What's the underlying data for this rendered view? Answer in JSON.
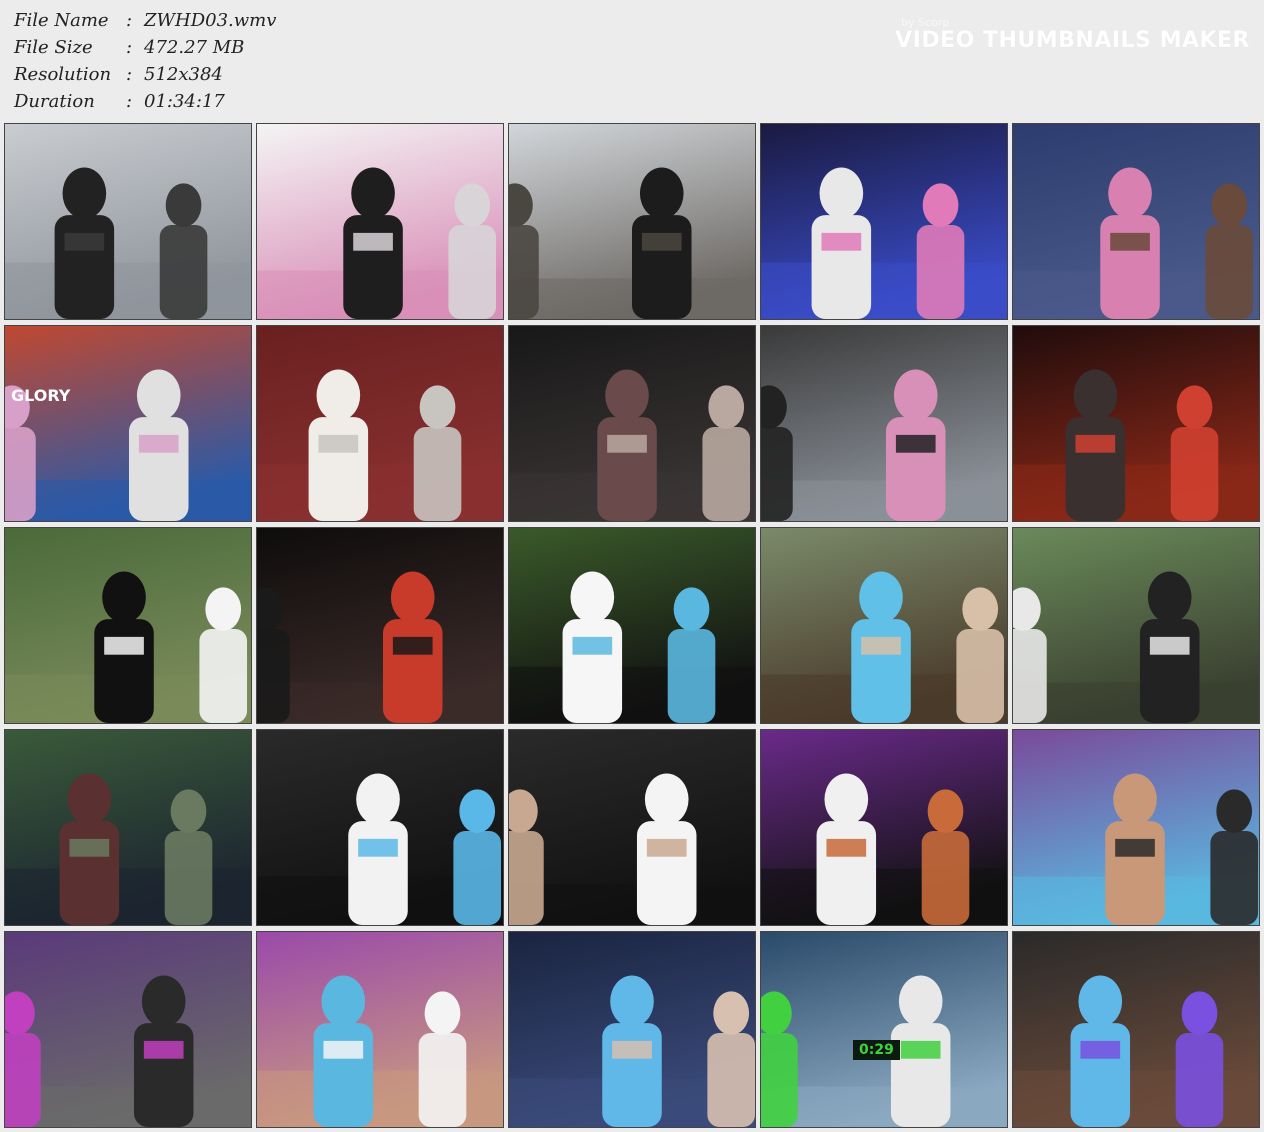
{
  "info": {
    "rows": [
      {
        "label": "File Name",
        "value": "ZWHD03.wmv"
      },
      {
        "label": "File Size",
        "value": "472.27 MB"
      },
      {
        "label": "Resolution",
        "value": "512x384"
      },
      {
        "label": "Duration",
        "value": "01:34:17"
      }
    ],
    "separator": ":"
  },
  "brand": {
    "by": "by Scorp",
    "name": "VIDEO THUMBNAILS MAKER"
  },
  "thumbnails": [
    {
      "scene": "harbor-fight",
      "palette": [
        "#c9ccd0",
        "#8f959c",
        "#222222",
        "#3a3a3a"
      ]
    },
    {
      "scene": "pink-skirt-low-angle",
      "palette": [
        "#f4f4f4",
        "#d98fb8",
        "#1e1e1e",
        "#d8d4d8"
      ]
    },
    {
      "scene": "cable-helmet-villain",
      "palette": [
        "#d2d6da",
        "#6e6a66",
        "#1c1c1c",
        "#4a4640"
      ]
    },
    {
      "scene": "blue-lab-interior",
      "palette": [
        "#1a1a40",
        "#3a4cc8",
        "#e8e8e8",
        "#e07ab8"
      ]
    },
    {
      "scene": "blue-truck-struggle",
      "palette": [
        "#2c3c6e",
        "#4a5a8a",
        "#d880b0",
        "#6a4a3a"
      ]
    },
    {
      "scene": "container-yard",
      "palette": [
        "#c04830",
        "#2a5aa8",
        "#e0e0e0",
        "#d8a0c8"
      ],
      "text": "GLORY"
    },
    {
      "scene": "white-boots",
      "palette": [
        "#6a2020",
        "#8a3030",
        "#f0ece8",
        "#c8c4c0"
      ]
    },
    {
      "scene": "night-sword-fight",
      "palette": [
        "#181818",
        "#3a3434",
        "#6a4a4a",
        "#b8a8a0"
      ]
    },
    {
      "scene": "warehouse-kick",
      "palette": [
        "#3a3a3a",
        "#8a9098",
        "#d890b8",
        "#222222"
      ]
    },
    {
      "scene": "dark-red-lair",
      "palette": [
        "#200c0c",
        "#8a2818",
        "#3a3030",
        "#d04030"
      ]
    },
    {
      "scene": "forest-masked-henchmen",
      "palette": [
        "#4a6a3a",
        "#7a8a5a",
        "#111111",
        "#f4f4f4"
      ]
    },
    {
      "scene": "lair-caped-figure",
      "palette": [
        "#0e0c0c",
        "#3a2a28",
        "#c83a2a",
        "#1a1a1a"
      ]
    },
    {
      "scene": "henchman-closeup-forest",
      "palette": [
        "#3a5a2a",
        "#111111",
        "#f6f6f6",
        "#5ab8e0"
      ]
    },
    {
      "scene": "heroine-against-tree",
      "palette": [
        "#7a8a6a",
        "#4a3a2a",
        "#60c0e8",
        "#d8c0a8"
      ]
    },
    {
      "scene": "officer-villain-forest",
      "palette": [
        "#6a8a5a",
        "#3a4030",
        "#222222",
        "#e8e8e8"
      ]
    },
    {
      "scene": "monster-in-woods",
      "palette": [
        "#3a5a3a",
        "#1c2430",
        "#5a3030",
        "#6a7a60"
      ]
    },
    {
      "scene": "three-henchmen-cage",
      "palette": [
        "#2a2a2a",
        "#111111",
        "#f2f2f2",
        "#5ab8e8"
      ]
    },
    {
      "scene": "henchman-face-closeup",
      "palette": [
        "#2a2a2a",
        "#111111",
        "#f4f4f4",
        "#c8a890"
      ]
    },
    {
      "scene": "purple-lit-capture",
      "palette": [
        "#6a2a8a",
        "#111111",
        "#f0f0f0",
        "#c86a3a"
      ]
    },
    {
      "scene": "heroine-headband-closeup",
      "palette": [
        "#7a4a9a",
        "#5ab8e0",
        "#c89878",
        "#2a2a2a"
      ]
    },
    {
      "scene": "control-panel-chain",
      "palette": [
        "#5a3a7a",
        "#6a6a6a",
        "#2a2a2a",
        "#c040c0"
      ]
    },
    {
      "scene": "heroine-bound-closeup",
      "palette": [
        "#9a4aaa",
        "#c89880",
        "#5ab8e0",
        "#f4f4f4"
      ]
    },
    {
      "scene": "heroine-in-cage",
      "palette": [
        "#1a2440",
        "#3a4a7a",
        "#60b8e8",
        "#d8c0b0"
      ]
    },
    {
      "scene": "bomb-timer",
      "palette": [
        "#2a4a6a",
        "#8aa8c0",
        "#e8e8e8",
        "#40d040"
      ],
      "text": "0:29"
    },
    {
      "scene": "energy-blast",
      "palette": [
        "#2a2a2a",
        "#6a4a3a",
        "#60b8e8",
        "#7a50e0"
      ]
    }
  ]
}
